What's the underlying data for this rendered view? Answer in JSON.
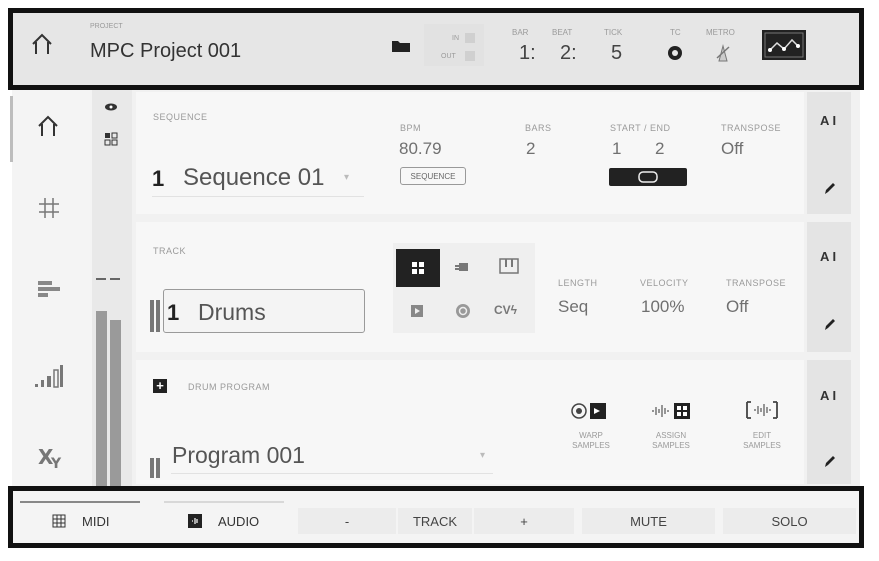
{
  "header": {
    "project_label": "PROJECT",
    "project_name": "MPC Project 001",
    "in_label": "IN",
    "out_label": "OUT",
    "bar_label": "BAR",
    "bar_value": "1:",
    "beat_label": "BEAT",
    "beat_value": "2:",
    "tick_label": "TICK",
    "tick_value": "5",
    "tc_label": "TC",
    "metro_label": "METRO"
  },
  "sequence": {
    "label": "SEQUENCE",
    "number": "1",
    "name": "Sequence 01",
    "bpm_label": "BPM",
    "bpm_value": "80.79",
    "sequence_button": "SEQUENCE",
    "bars_label": "BARS",
    "bars_value": "2",
    "start_end_label": "START / END",
    "start_value": "1",
    "end_value": "2",
    "transpose_label": "TRANSPOSE",
    "transpose_value": "Off"
  },
  "track": {
    "label": "TRACK",
    "number": "1",
    "name": "Drums",
    "cv_label": "CVϟ",
    "length_label": "LENGTH",
    "length_value": "Seq",
    "velocity_label": "VELOCITY",
    "velocity_value": "100%",
    "transpose_label": "TRANSPOSE",
    "transpose_value": "Off"
  },
  "program": {
    "label": "DRUM PROGRAM",
    "name": "Program 001",
    "warp_label": "WARP SAMPLES",
    "assign_label": "ASSIGN SAMPLES",
    "edit_label": "EDIT SAMPLES"
  },
  "edit_buttons": {
    "text_icon": "A I"
  },
  "footer": {
    "midi_label": "MIDI",
    "audio_label": "AUDIO",
    "minus_label": "-",
    "track_label": "TRACK",
    "plus_label": "+",
    "mute_label": "MUTE",
    "solo_label": "SOLO"
  },
  "icons": {
    "home": "home-icon",
    "grid": "grid-icon",
    "bars": "bars-icon",
    "levels": "levels-icon",
    "xy": "xy-icon",
    "folder": "folder-icon",
    "metronome": "metronome-icon",
    "automation": "automation-icon",
    "pencil": "pencil-icon"
  },
  "colors": {
    "frame": "#111111",
    "panel": "#f7f7f7",
    "topbar": "#e6e6e6",
    "dark_button": "#222222"
  }
}
